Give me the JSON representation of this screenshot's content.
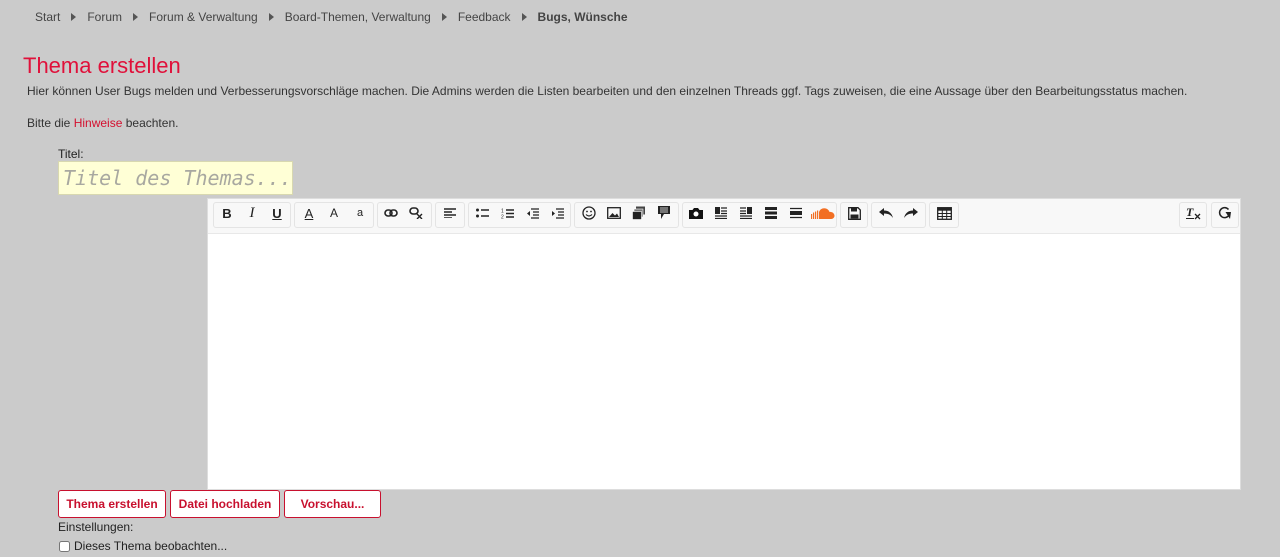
{
  "breadcrumb": [
    "Start",
    "Forum",
    "Forum & Verwaltung",
    "Board-Themen, Verwaltung",
    "Feedback"
  ],
  "breadcrumb_current": "Bugs, Wünsche",
  "page": {
    "title": "Thema erstellen",
    "description": "Hier können User Bugs melden und Verbesserungsvorschläge machen. Die Admins werden die Listen bearbeiten und den einzelnen Threads ggf. Tags zuweisen, die eine Aussage über den Bearbeitungsstatus machen.",
    "hint_before": "Bitte die",
    "hint_link": "Hinweise",
    "hint_after": "beachten."
  },
  "form": {
    "title_label": "Titel:",
    "title_placeholder": "Titel des Themas...",
    "title_value": ""
  },
  "toolbar": {
    "bold": "B",
    "italic": "I",
    "underline": "U",
    "font_color": "A",
    "font_size": "A",
    "font_family": "a"
  },
  "buttons": {
    "create": "Thema erstellen",
    "upload": "Datei hochladen",
    "preview": "Vorschau..."
  },
  "settings": {
    "label": "Einstellungen:",
    "watch_label": "Dieses Thema beobachten...",
    "watch_checked": false
  },
  "colors": {
    "accent": "#e0103a",
    "background": "#cbcbcb",
    "soundcloud": "#f26f23"
  }
}
